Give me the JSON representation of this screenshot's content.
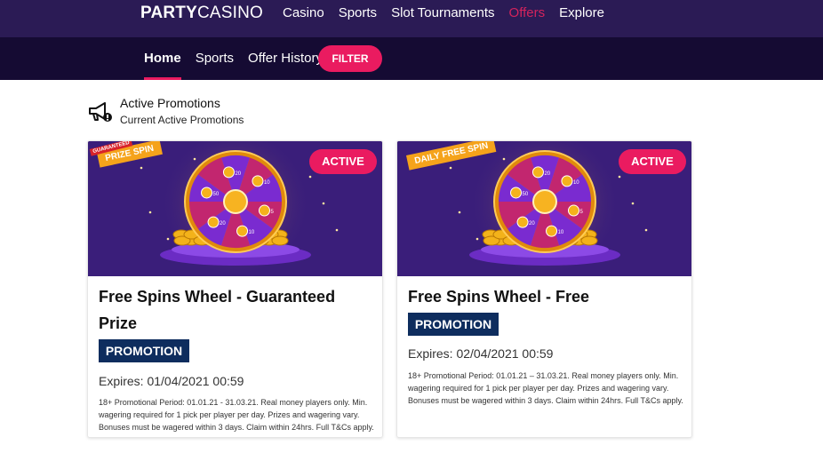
{
  "brand": {
    "name_bold": "PARTY",
    "name_light": "CASINO"
  },
  "top_nav": [
    "Casino",
    "Sports",
    "Slot Tournaments",
    "Offers",
    "Explore"
  ],
  "sub_nav": [
    "Home",
    "Sports",
    "Offer History"
  ],
  "filter_label": "FILTER",
  "section": {
    "title": "Active Promotions",
    "subtitle": "Current Active Promotions"
  },
  "cards": [
    {
      "ribbon_tag": "GUARANTEED",
      "ribbon": "PRIZE SPIN",
      "status": "ACTIVE",
      "title": "Free Spins Wheel - Guaranteed Prize",
      "badge": "PROMOTION",
      "expires": "Expires: 01/04/2021 00:59",
      "terms": "18+ Promotional Period: 01.01.21 - 31.03.21. Real money players only. Min. wagering required for 1 pick per player per day. Prizes and wagering vary. Bonuses must be wagered within 3 days. Claim within 24hrs. Full T&Cs apply."
    },
    {
      "ribbon_tag": "",
      "ribbon": "DAILY FREE SPIN",
      "status": "ACTIVE",
      "title": "Free Spins Wheel - Free",
      "badge": "PROMOTION",
      "expires": "Expires: 02/04/2021 00:59",
      "terms": "18+ Promotional Period: 01.01.21 – 31.03.21. Real money players only. Min. wagering required for 1 pick per player per day. Prizes and wagering vary. Bonuses must be wagered within 3 days. Claim within 24hrs. Full T&Cs apply."
    }
  ],
  "wheel_numbers": [
    "5",
    "10",
    "20",
    "50",
    "20",
    "10"
  ],
  "colors": {
    "nav_bg": "#2b1b55",
    "subnav_bg": "#150b33",
    "accent": "#ea1b60",
    "promo_badge": "#0e2d5e"
  }
}
